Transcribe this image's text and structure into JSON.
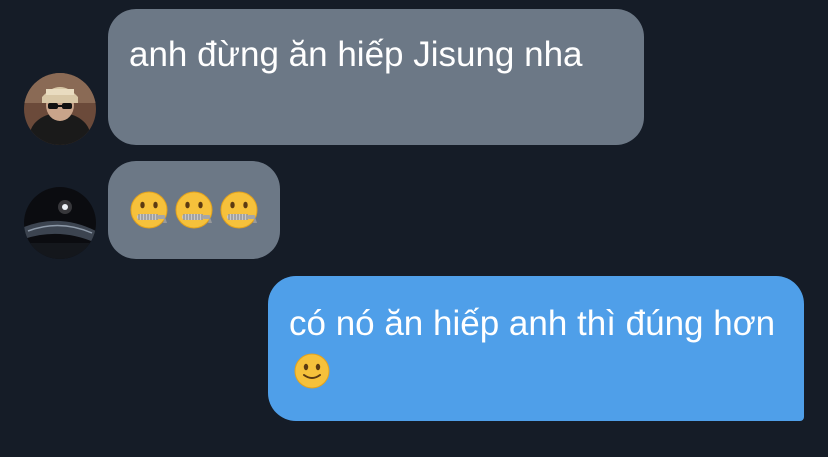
{
  "conversation": {
    "messages": [
      {
        "direction": "incoming",
        "text": "anh đừng ăn hiếp Jisung nha"
      },
      {
        "direction": "incoming",
        "emojis": [
          "zipper-mouth-face",
          "zipper-mouth-face",
          "zipper-mouth-face"
        ]
      },
      {
        "direction": "outgoing",
        "text": "có nó ăn hiếp anh thì đúng hơn",
        "trailing_emoji": "slightly-smiling-face"
      }
    ]
  },
  "colors": {
    "background": "#151c27",
    "incoming_bubble": "#6c7886",
    "outgoing_bubble": "#4f9fe9",
    "text": "#ffffff"
  }
}
